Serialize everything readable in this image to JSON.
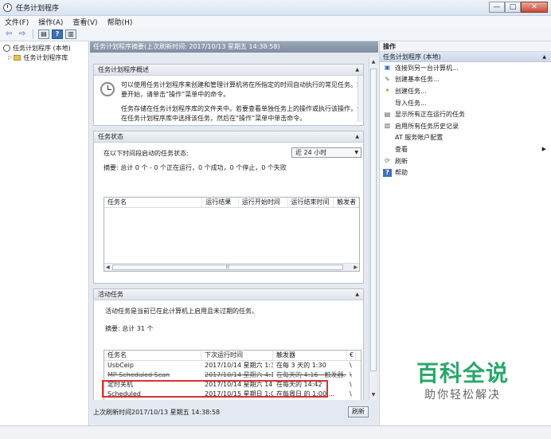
{
  "window": {
    "title": "任务计划程序",
    "minimize": "—",
    "maximize": "□",
    "close": "✕"
  },
  "menu": [
    "文件(F)",
    "操作(A)",
    "查看(V)",
    "帮助(H)"
  ],
  "toolbar": {
    "back": "⇦",
    "forward": "⇨",
    "view": "▤",
    "help": "?",
    "extra": "▥"
  },
  "tree": {
    "root": "任务计划程序 (本地)",
    "child": "任务计划程序库"
  },
  "center": {
    "header": "任务计划程序摘要(上次刷新时间: 2017/10/13 星期五 14:38:58)",
    "overview": {
      "title": "任务计划程序概述",
      "line1": "可以使用任务计划程序来创建和管理计算机将在所指定的时间自动执行的常见任务。若",
      "line2": "要开始，请单击“操作”菜单中的命令。",
      "line3": "任务存储在任务计划程序库的文件夹中。若要查看单独任务上的操作或执行该操作，请",
      "line4": "在任务计划程序库中选择该任务，然后在“操作”菜单中单击命令。"
    },
    "status": {
      "title": "任务状态",
      "period_label": "在以下时间段启动的任务状态:",
      "period_value": "近 24 小时",
      "summary": "摘要: 总计 0 个 - 0 个正在运行，0 个成功，0 个停止，0 个失败",
      "columns": [
        "任务名",
        "运行结果",
        "运行开始时间",
        "运行结束时间",
        "触发者"
      ]
    },
    "active": {
      "title": "活动任务",
      "desc": "活动任务是当前已在此计算机上启用且未过期的任务。",
      "summary": "摘要: 总计 31 个",
      "columns": [
        "任务名",
        "下次运行时间",
        "触发器",
        "€"
      ],
      "rows": [
        {
          "name": "UsbCeip",
          "next": "2017/10/14 星期六 1:3...",
          "trigger": "在每 3 天的 1:30",
          "loc": "\\"
        },
        {
          "name": "MP Scheduled Scan",
          "next": "2017/10/14 星期六 4:1...",
          "trigger": "在每天的 4:16 - 触发器...",
          "loc": "\\"
        },
        {
          "name": "定时关机",
          "next": "2017/10/14 星期六 14:...",
          "trigger": "在每天的 14:42",
          "loc": "\\"
        },
        {
          "name": "Scheduled",
          "next": "2017/10/15 星期日 1:0...",
          "trigger": "在每周日 的 1:00 ...",
          "loc": "\\"
        }
      ]
    },
    "last_refresh": "上次刷新时间2017/10/13 星期五 14:38:58",
    "refresh_button": "刷新"
  },
  "actions": {
    "header": "操作",
    "sub": "任务计划程序 (本地)",
    "items": [
      {
        "icon": "connect-icon",
        "label": "连接到另一台计算机..."
      },
      {
        "icon": "create-basic-task-icon",
        "label": "创建基本任务..."
      },
      {
        "icon": "create-task-icon",
        "label": "创建任务..."
      },
      {
        "icon": "",
        "label": "导入任务..."
      },
      {
        "icon": "running-tasks-icon",
        "label": "显示所有正在运行的任务"
      },
      {
        "icon": "history-icon",
        "label": "启用所有任务历史记录"
      },
      {
        "icon": "",
        "label": "AT 服务帐户配置"
      },
      {
        "icon": "",
        "label": "查看"
      },
      {
        "icon": "refresh-icon",
        "label": "刷新"
      },
      {
        "icon": "help-icon",
        "label": "帮助"
      }
    ]
  },
  "watermark": {
    "main": "百科全说",
    "sub": "助你轻松解决"
  },
  "colors": {
    "highlight": "#d9312d",
    "watermark": "#2aa76a"
  }
}
